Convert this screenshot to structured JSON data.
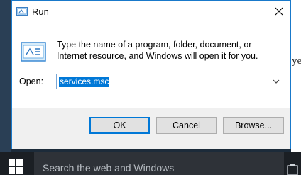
{
  "dialog": {
    "title": "Run",
    "description": "Type the name of a program, folder, document, or Internet resource, and Windows will open it for you.",
    "open_label": "Open:",
    "open_value": "services.msc",
    "ok_label": "OK",
    "cancel_label": "Cancel",
    "browse_label": "Browse..."
  },
  "taskbar": {
    "search_placeholder": "Search the web and Windows"
  },
  "background": {
    "partial_text": "ye"
  },
  "colors": {
    "accent": "#0078d7",
    "taskbar": "#1b1f24",
    "search_box": "#2e3238"
  }
}
